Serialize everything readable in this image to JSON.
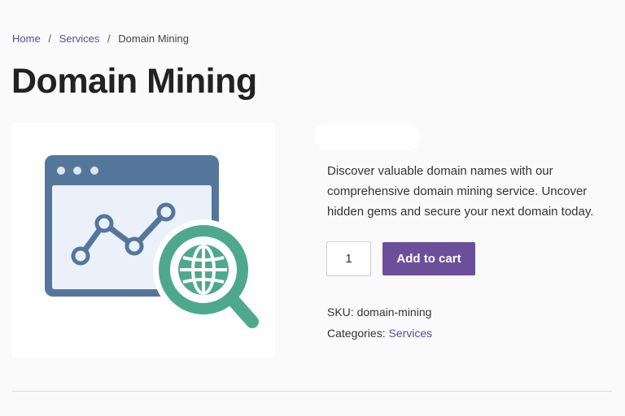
{
  "breadcrumb": {
    "home": "Home",
    "services": "Services",
    "current": "Domain Mining",
    "separator": "/"
  },
  "product": {
    "title": "Domain Mining",
    "description": "Discover valuable domain names with our comprehensive domain mining service. Uncover hidden gems and secure your next domain today.",
    "quantity": "1",
    "add_to_cart_label": "Add to cart",
    "sku_label": "SKU:",
    "sku_value": "domain-mining",
    "categories_label": "Categories:",
    "category": "Services"
  },
  "image": {
    "icon": "browser-chart-globe-search-icon"
  },
  "colors": {
    "accent": "#6b4f9b",
    "link": "#5b4a9a",
    "browser_frame": "#55769b",
    "magnifier": "#4ea98c"
  }
}
